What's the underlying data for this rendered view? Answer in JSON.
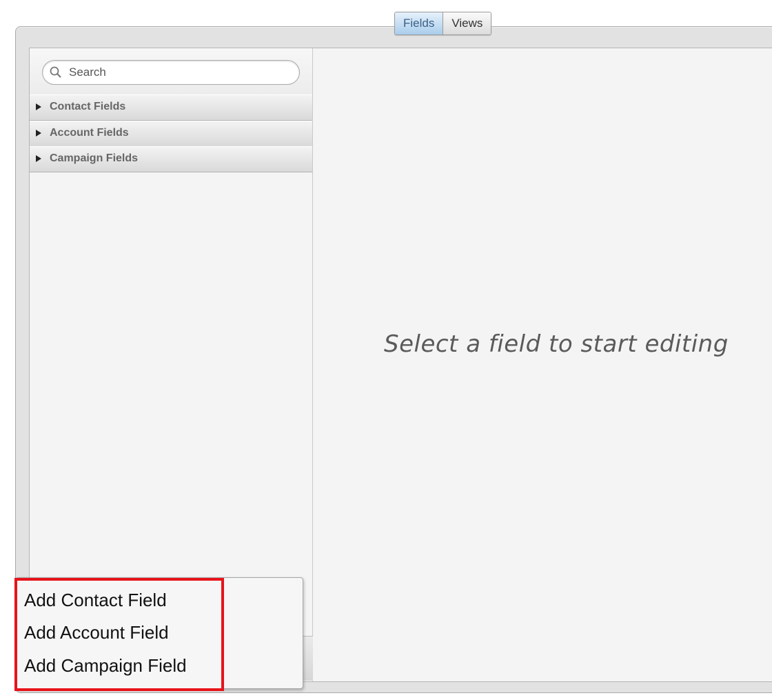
{
  "tabs": [
    {
      "label": "Fields",
      "active": true
    },
    {
      "label": "Views",
      "active": false
    }
  ],
  "search": {
    "placeholder": "Search",
    "icon": "search-icon"
  },
  "sidebar": {
    "groups": [
      {
        "label": "Contact Fields",
        "icon": "triangle-right-icon"
      },
      {
        "label": "Account Fields",
        "icon": "triangle-right-icon"
      },
      {
        "label": "Campaign Fields",
        "icon": "triangle-right-icon"
      }
    ]
  },
  "main": {
    "empty_message": "Select a field to start editing"
  },
  "add_menu": {
    "items": [
      {
        "label": "Add Contact Field"
      },
      {
        "label": "Add Account Field"
      },
      {
        "label": "Add Campaign Field"
      }
    ],
    "highlight_color": "#e8131a"
  },
  "colors": {
    "active_tab": "#a9cdec",
    "panel_background": "#f4f4f4"
  }
}
